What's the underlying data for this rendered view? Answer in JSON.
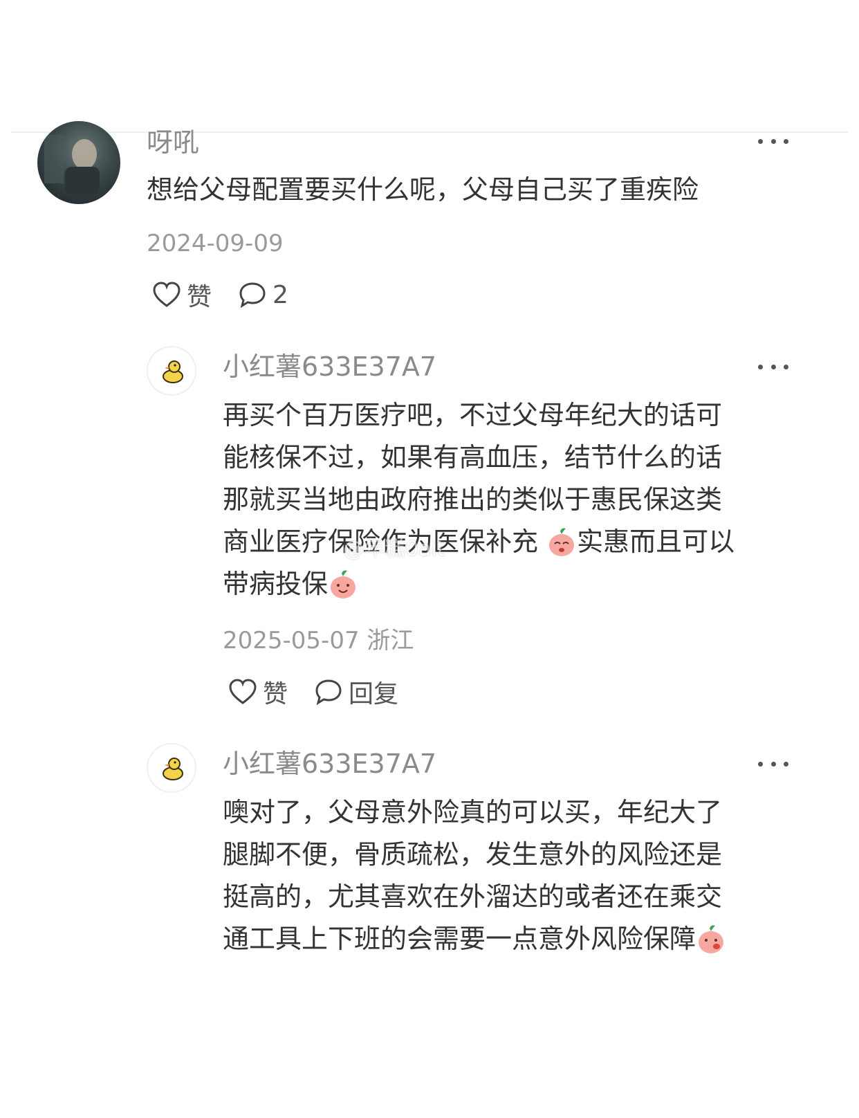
{
  "main_comment": {
    "username": "呀吼",
    "text": "想给父母配置要买什么呢，父母自己买了重疾险",
    "date": "2024-09-09",
    "like_label": "赞",
    "comment_count": "2"
  },
  "replies": [
    {
      "username": "小红薯633E37A7",
      "lines": [
        "再买个百万医疗吧，不过父母年纪大的话可",
        "能核保不过，如果有高血压，结节什么的话",
        "那就买当地由政府推出的类似于惠民保这类"
      ],
      "line4_a": "商业医疗保险作为医保补充",
      "line4_b": "实惠而且可以",
      "line5": "带病投保",
      "meta": "2025-05-07 浙江",
      "like_label": "赞",
      "reply_label": "回复"
    },
    {
      "username": "小红薯633E37A7",
      "lines": [
        "噢对了，父母意外险真的可以买，年纪大了",
        "腿脚不便，骨质疏松，发生意外的风险还是",
        "挺高的，尤其喜欢在外溜达的或者还在乘交"
      ],
      "line4": "通工具上下班的会需要一点意外风险保障"
    }
  ],
  "watermark": "@年糕0ait"
}
